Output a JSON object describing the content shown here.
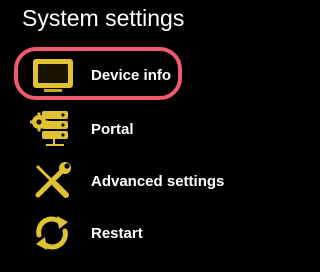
{
  "header": {
    "title": "System settings"
  },
  "menu": {
    "items": [
      {
        "label": "Device info",
        "icon": "monitor-icon",
        "selected": true
      },
      {
        "label": "Portal",
        "icon": "server-gear-icon",
        "selected": false
      },
      {
        "label": "Advanced settings",
        "icon": "wrench-screwdriver-icon",
        "selected": false
      },
      {
        "label": "Restart",
        "icon": "refresh-arrows-icon",
        "selected": false
      }
    ]
  },
  "colors": {
    "background": "#000000",
    "icon": "#e1c233",
    "selection": "#f05a6e",
    "text": "#ffffff"
  }
}
